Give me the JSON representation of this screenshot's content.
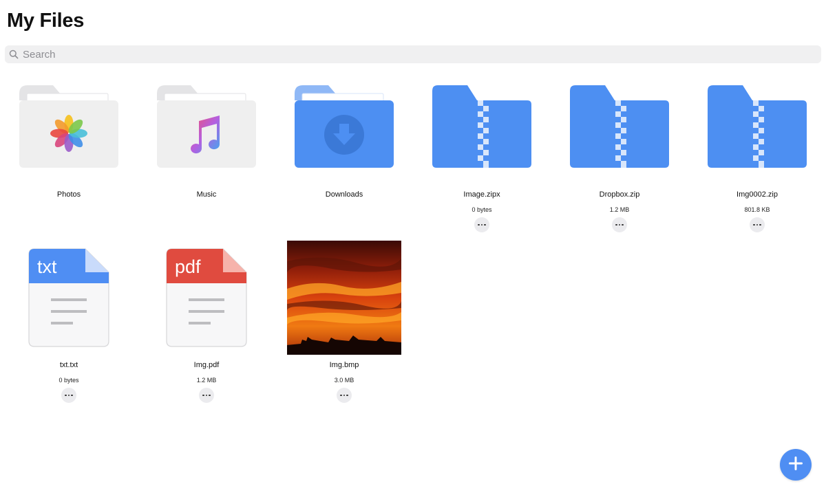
{
  "header": {
    "title": "My Files"
  },
  "search": {
    "placeholder": "Search",
    "value": ""
  },
  "colors": {
    "accent": "#4f8ef3",
    "folder_blue": "#4d8ff2",
    "folder_gray": "#efefef",
    "txt_header": "#4f8ef3",
    "pdf_header": "#e04b3f"
  },
  "items": [
    {
      "name": "Photos",
      "kind": "folder",
      "icon": "photos-folder-icon"
    },
    {
      "name": "Music",
      "kind": "folder",
      "icon": "music-folder-icon"
    },
    {
      "name": "Downloads",
      "kind": "folder",
      "icon": "downloads-folder-icon"
    },
    {
      "name": "Image.zipx",
      "size": "0 bytes",
      "kind": "zip",
      "icon": "zip-folder-icon"
    },
    {
      "name": "Dropbox.zip",
      "size": "1.2 MB",
      "kind": "zip",
      "icon": "zip-folder-icon"
    },
    {
      "name": "Img0002.zip",
      "size": "801.8 KB",
      "kind": "zip",
      "icon": "zip-folder-icon"
    },
    {
      "name": "txt.txt",
      "size": "0 bytes",
      "kind": "txt",
      "icon": "txt-file-icon",
      "label": "txt"
    },
    {
      "name": "Img.pdf",
      "size": "1.2 MB",
      "kind": "pdf",
      "icon": "pdf-file-icon",
      "label": "pdf"
    },
    {
      "name": "Img.bmp",
      "size": "3.0 MB",
      "kind": "image",
      "icon": "image-thumbnail"
    }
  ],
  "fab": {
    "icon": "plus-icon"
  }
}
